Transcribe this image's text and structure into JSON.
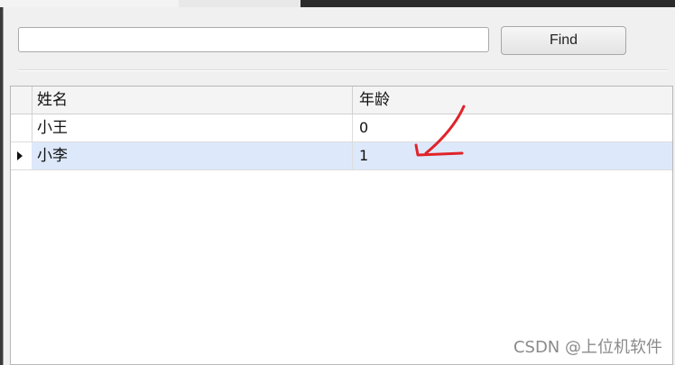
{
  "search": {
    "value": "",
    "placeholder": ""
  },
  "find_button": {
    "label": "Find"
  },
  "grid": {
    "columns": [
      "姓名",
      "年龄"
    ],
    "rows": [
      {
        "name": "小王",
        "age": "0",
        "selected": false
      },
      {
        "name": "小李",
        "age": "1",
        "selected": true
      }
    ]
  },
  "watermark": "CSDN @上位机软件",
  "colors": {
    "selected_row": "#dde8fb",
    "annotation": "#e0242a"
  }
}
